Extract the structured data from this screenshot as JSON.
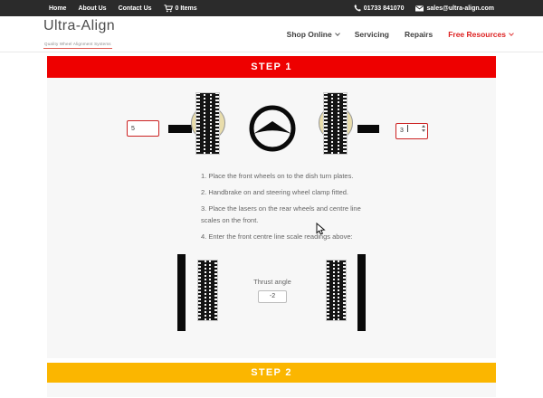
{
  "topbar": {
    "links": [
      {
        "label": "Home"
      },
      {
        "label": "About Us"
      },
      {
        "label": "Contact Us"
      }
    ],
    "cart": {
      "label": "0 Items"
    },
    "phone": "01733 841070",
    "email": "sales@ultra-align.com"
  },
  "header": {
    "logo": {
      "title": "Ultra-Align",
      "tagline": "Quality Wheel Alignment Systems"
    },
    "nav": [
      {
        "label": "Shop Online",
        "dropdown": true
      },
      {
        "label": "Servicing",
        "dropdown": false
      },
      {
        "label": "Repairs",
        "dropdown": false
      },
      {
        "label": "Free Resources",
        "dropdown": true
      }
    ]
  },
  "step1": {
    "banner_label": "STEP 1",
    "front_left_reading": "5",
    "front_right_reading": "3",
    "instructions": [
      "1. Place the front wheels on to the dish turn plates.",
      "2. Handbrake on and steering wheel clamp fitted.",
      "3. Place the lasers on the rear wheels and centre line scales on the front.",
      "4. Enter the front centre line scale readings above:"
    ],
    "thrust": {
      "label": "Thrust angle",
      "value": "-2"
    }
  },
  "step2": {
    "banner_label": "STEP 2"
  },
  "colors": {
    "step1-red": "#ee0000",
    "step2-yellow": "#fbb600",
    "nav-accent-red": "#dd2222",
    "input-border-red": "#cc2222",
    "topbar-bg": "#2b2b2b",
    "panel-bg": "#f7f7f7",
    "plate-tan": "#e9ddab"
  }
}
